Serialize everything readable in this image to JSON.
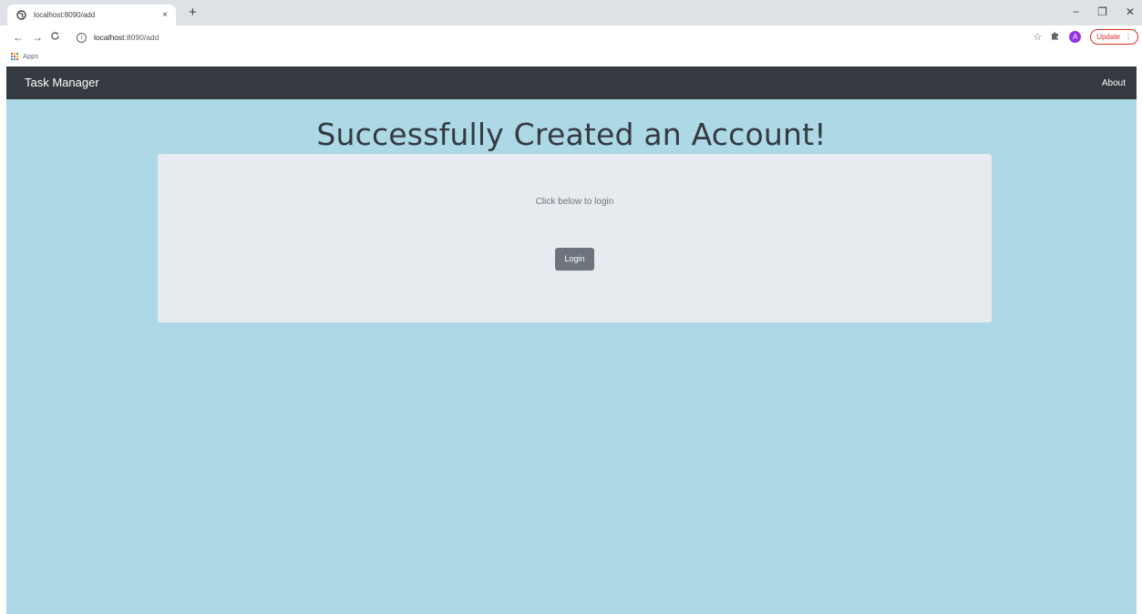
{
  "browser": {
    "tab_title": "localhost:8090/add",
    "tab_close": "×",
    "new_tab": "+",
    "window": {
      "minimize": "−",
      "restore": "❐",
      "close": "✕"
    },
    "url_host": "localhost",
    "url_path": ":8090/add",
    "update_label": "Update",
    "avatar_letter": "A",
    "bookmarks": {
      "apps_label": "Apps"
    }
  },
  "navbar": {
    "brand": "Task Manager",
    "about": "About"
  },
  "main": {
    "heading": "Successfully Created an Account!",
    "card_text": "Click below to login",
    "login_button": "Login"
  },
  "colors": {
    "page_background": "#add8e6",
    "navbar": "#343a40",
    "card": "#e7eaee",
    "button": "#6c757d"
  }
}
